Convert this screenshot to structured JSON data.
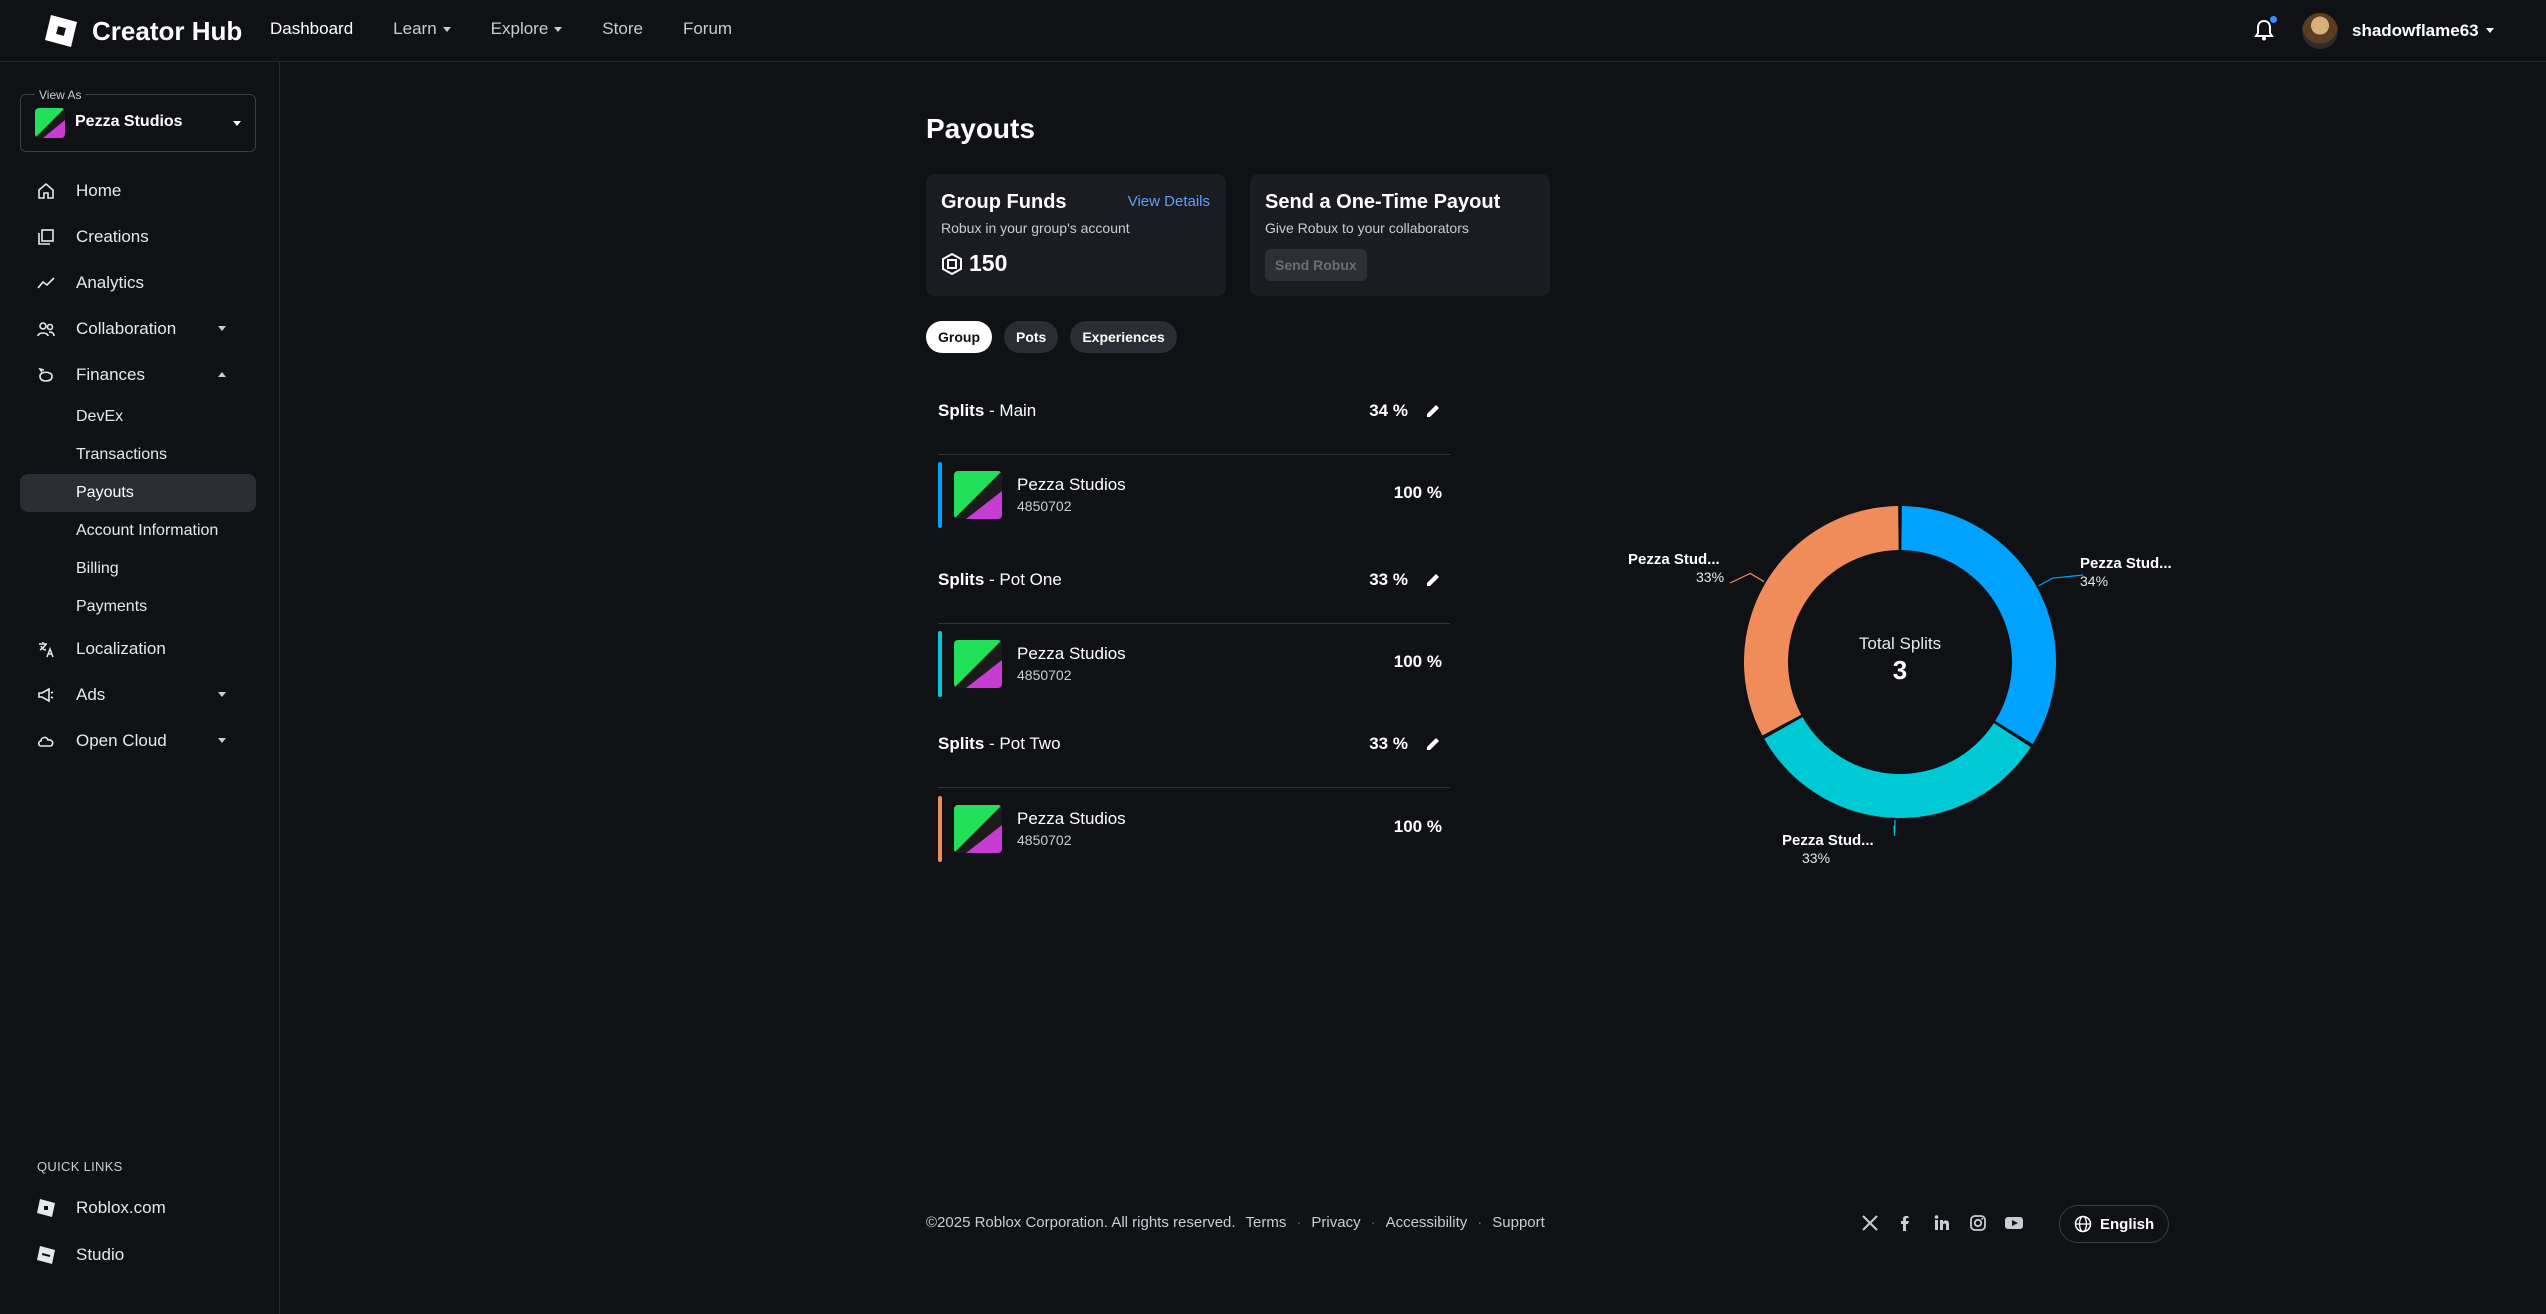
{
  "app": {
    "name": "Creator Hub"
  },
  "topnav": {
    "items": [
      {
        "label": "Dashboard",
        "active": true,
        "dropdown": false
      },
      {
        "label": "Learn",
        "active": false,
        "dropdown": true
      },
      {
        "label": "Explore",
        "active": false,
        "dropdown": true
      },
      {
        "label": "Store",
        "active": false,
        "dropdown": false
      },
      {
        "label": "Forum",
        "active": false,
        "dropdown": false
      }
    ],
    "username": "shadowflame63"
  },
  "sidebar": {
    "view_as_label": "View As",
    "view_as_value": "Pezza Studios",
    "items": [
      {
        "label": "Home",
        "icon": "home-icon"
      },
      {
        "label": "Creations",
        "icon": "creations-icon"
      },
      {
        "label": "Analytics",
        "icon": "analytics-icon"
      },
      {
        "label": "Collaboration",
        "icon": "collaboration-icon"
      },
      {
        "label": "Finances",
        "icon": "finances-icon"
      }
    ],
    "finance_subitems": [
      "DevEx",
      "Transactions",
      "Payouts",
      "Account Information",
      "Billing",
      "Payments"
    ],
    "active_subitem": "Payouts",
    "lower_items": [
      {
        "label": "Localization",
        "icon": "localization-icon"
      },
      {
        "label": "Ads",
        "icon": "ads-icon"
      },
      {
        "label": "Open Cloud",
        "icon": "cloud-icon"
      }
    ],
    "quick_links_title": "QUICK LINKS",
    "quick_links": [
      "Roblox.com",
      "Studio"
    ]
  },
  "main": {
    "title": "Payouts",
    "group_funds": {
      "title": "Group Funds",
      "link": "View Details",
      "subtitle": "Robux in your group's account",
      "amount": "150"
    },
    "one_time": {
      "title": "Send a One-Time Payout",
      "subtitle": "Give Robux to your collaborators",
      "button": "Send Robux"
    },
    "tabs": [
      "Group",
      "Pots",
      "Experiences"
    ],
    "active_tab": "Group",
    "splits": [
      {
        "prefix": "Splits",
        "name": "- Main",
        "pct": "34",
        "member_name": "Pezza Studios",
        "member_id": "4850702",
        "member_pct": "100",
        "color": "#00a2ff"
      },
      {
        "prefix": "Splits",
        "name": "- Pot One",
        "pct": "33",
        "member_name": "Pezza Studios",
        "member_id": "4850702",
        "member_pct": "100",
        "color": "#00c9d6"
      },
      {
        "prefix": "Splits",
        "name": "- Pot Two",
        "pct": "33",
        "member_name": "Pezza Studios",
        "member_id": "4850702",
        "member_pct": "100",
        "color": "#f08c5a"
      }
    ],
    "pct_sign": "%"
  },
  "chart_data": {
    "type": "pie",
    "donut": true,
    "center_label": "Total Splits",
    "center_value": "3",
    "slices": [
      {
        "label": "Pezza Stud...",
        "value": 34,
        "display": "34%",
        "color": "#00a2ff"
      },
      {
        "label": "Pezza Stud...",
        "value": 33,
        "display": "33%",
        "color": "#00c9d6"
      },
      {
        "label": "Pezza Stud...",
        "value": 33,
        "display": "33%",
        "color": "#f08c5a"
      }
    ]
  },
  "footer": {
    "copyright": "©2025 Roblox Corporation. All rights reserved.",
    "links": [
      "Terms",
      "Privacy",
      "Accessibility",
      "Support"
    ],
    "language": "English"
  }
}
